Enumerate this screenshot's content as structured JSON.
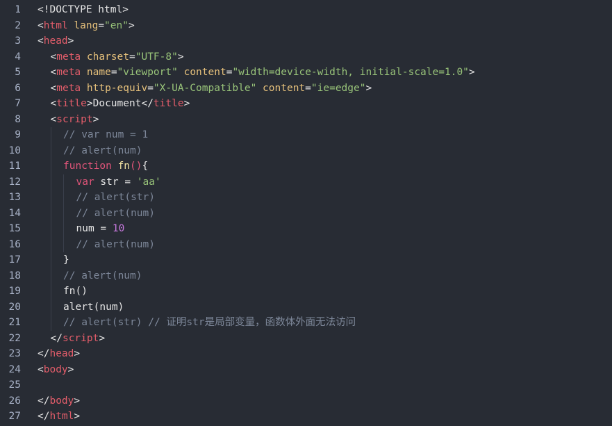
{
  "editor": {
    "lines": [
      {
        "n": "1",
        "indent": 0,
        "tokens": [
          {
            "t": "<!DOCTYPE html>",
            "c": "doctype"
          }
        ]
      },
      {
        "n": "2",
        "indent": 0,
        "tokens": [
          {
            "t": "<",
            "c": "punct"
          },
          {
            "t": "html",
            "c": "tag"
          },
          {
            "t": " lang",
            "c": "attr"
          },
          {
            "t": "=",
            "c": "punct"
          },
          {
            "t": "\"en\"",
            "c": "str"
          },
          {
            "t": ">",
            "c": "punct"
          }
        ]
      },
      {
        "n": "3",
        "indent": 0,
        "tokens": [
          {
            "t": "<",
            "c": "punct"
          },
          {
            "t": "head",
            "c": "tag"
          },
          {
            "t": ">",
            "c": "punct"
          }
        ]
      },
      {
        "n": "4",
        "indent": 1,
        "tokens": [
          {
            "t": "<",
            "c": "punct"
          },
          {
            "t": "meta",
            "c": "tag"
          },
          {
            "t": " charset",
            "c": "attr"
          },
          {
            "t": "=",
            "c": "punct"
          },
          {
            "t": "\"UTF-8\"",
            "c": "str"
          },
          {
            "t": ">",
            "c": "punct"
          }
        ]
      },
      {
        "n": "5",
        "indent": 1,
        "tokens": [
          {
            "t": "<",
            "c": "punct"
          },
          {
            "t": "meta",
            "c": "tag"
          },
          {
            "t": " name",
            "c": "attr"
          },
          {
            "t": "=",
            "c": "punct"
          },
          {
            "t": "\"viewport\"",
            "c": "str"
          },
          {
            "t": " content",
            "c": "attr"
          },
          {
            "t": "=",
            "c": "punct"
          },
          {
            "t": "\"width=device-width, initial-scale=1.0\"",
            "c": "str"
          },
          {
            "t": ">",
            "c": "punct"
          }
        ]
      },
      {
        "n": "6",
        "indent": 1,
        "tokens": [
          {
            "t": "<",
            "c": "punct"
          },
          {
            "t": "meta",
            "c": "tag"
          },
          {
            "t": " http-equiv",
            "c": "attr"
          },
          {
            "t": "=",
            "c": "punct"
          },
          {
            "t": "\"X-UA-Compatible\"",
            "c": "str"
          },
          {
            "t": " content",
            "c": "attr"
          },
          {
            "t": "=",
            "c": "punct"
          },
          {
            "t": "\"ie=edge\"",
            "c": "str"
          },
          {
            "t": ">",
            "c": "punct"
          }
        ]
      },
      {
        "n": "7",
        "indent": 1,
        "tokens": [
          {
            "t": "<",
            "c": "punct"
          },
          {
            "t": "title",
            "c": "tag"
          },
          {
            "t": ">Document</",
            "c": "plain"
          },
          {
            "t": "title",
            "c": "tag"
          },
          {
            "t": ">",
            "c": "punct"
          }
        ]
      },
      {
        "n": "8",
        "indent": 1,
        "tokens": [
          {
            "t": "<",
            "c": "punct"
          },
          {
            "t": "script",
            "c": "tag"
          },
          {
            "t": ">",
            "c": "punct"
          }
        ]
      },
      {
        "n": "9",
        "indent": 2,
        "tokens": [
          {
            "t": "// var num = 1",
            "c": "comment"
          }
        ]
      },
      {
        "n": "10",
        "indent": 2,
        "tokens": [
          {
            "t": "// alert(num)",
            "c": "comment"
          }
        ]
      },
      {
        "n": "11",
        "indent": 2,
        "tokens": [
          {
            "t": "function",
            "c": "kw"
          },
          {
            "t": " ",
            "c": "plain"
          },
          {
            "t": "fn",
            "c": "fn"
          },
          {
            "t": "()",
            "c": "kw"
          },
          {
            "t": "{",
            "c": "plain"
          }
        ]
      },
      {
        "n": "12",
        "indent": 3,
        "tokens": [
          {
            "t": "var",
            "c": "kw"
          },
          {
            "t": " str = ",
            "c": "plain"
          },
          {
            "t": "'aa'",
            "c": "str"
          }
        ]
      },
      {
        "n": "13",
        "indent": 3,
        "tokens": [
          {
            "t": "// alert(str)",
            "c": "comment"
          }
        ]
      },
      {
        "n": "14",
        "indent": 3,
        "tokens": [
          {
            "t": "// alert(num)",
            "c": "comment"
          }
        ]
      },
      {
        "n": "15",
        "indent": 3,
        "tokens": [
          {
            "t": "num = ",
            "c": "plain"
          },
          {
            "t": "10",
            "c": "num"
          }
        ]
      },
      {
        "n": "16",
        "indent": 3,
        "tokens": [
          {
            "t": "// alert(num)",
            "c": "comment"
          }
        ]
      },
      {
        "n": "17",
        "indent": 2,
        "tokens": [
          {
            "t": "}",
            "c": "plain"
          }
        ]
      },
      {
        "n": "18",
        "indent": 2,
        "tokens": [
          {
            "t": "// alert(num)",
            "c": "comment"
          }
        ]
      },
      {
        "n": "19",
        "indent": 2,
        "tokens": [
          {
            "t": "fn()",
            "c": "plain"
          }
        ]
      },
      {
        "n": "20",
        "indent": 2,
        "tokens": [
          {
            "t": "alert(num)",
            "c": "plain"
          }
        ]
      },
      {
        "n": "21",
        "indent": 2,
        "tokens": [
          {
            "t": "// alert(str) // 证明str是局部变量，函数体外面无法访问",
            "c": "comment"
          }
        ]
      },
      {
        "n": "22",
        "indent": 1,
        "tokens": [
          {
            "t": "</",
            "c": "punct"
          },
          {
            "t": "script",
            "c": "tag"
          },
          {
            "t": ">",
            "c": "punct"
          }
        ]
      },
      {
        "n": "23",
        "indent": 0,
        "tokens": [
          {
            "t": "</",
            "c": "punct"
          },
          {
            "t": "head",
            "c": "tag"
          },
          {
            "t": ">",
            "c": "punct"
          }
        ]
      },
      {
        "n": "24",
        "indent": 0,
        "tokens": [
          {
            "t": "<",
            "c": "punct"
          },
          {
            "t": "body",
            "c": "tag"
          },
          {
            "t": ">",
            "c": "punct"
          }
        ]
      },
      {
        "n": "25",
        "indent": 0,
        "tokens": []
      },
      {
        "n": "26",
        "indent": 0,
        "tokens": [
          {
            "t": "</",
            "c": "punct"
          },
          {
            "t": "body",
            "c": "tag"
          },
          {
            "t": ">",
            "c": "punct"
          }
        ]
      },
      {
        "n": "27",
        "indent": 0,
        "tokens": [
          {
            "t": "</",
            "c": "punct"
          },
          {
            "t": "html",
            "c": "tag"
          },
          {
            "t": ">",
            "c": "punct"
          }
        ]
      }
    ]
  },
  "colors": {
    "background": "#282c34",
    "line_number": "#a8b2c7",
    "tag": "#e35d6a",
    "attribute": "#e5c07b",
    "string": "#98c379",
    "keyword": "#e2557a",
    "number": "#c678dd",
    "comment": "#7d8799"
  }
}
